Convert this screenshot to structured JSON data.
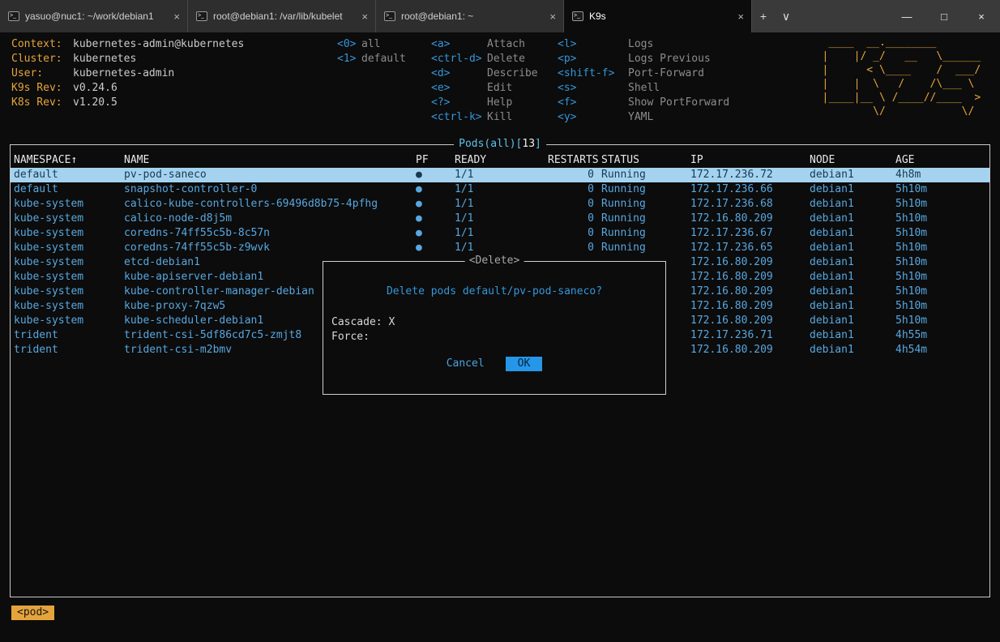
{
  "colors": {
    "accent_orange": "#e5a43b",
    "hotkey_blue": "#3596d8",
    "row_blue": "#57a7e0",
    "selected_row_bg": "#a5d3ef",
    "ok_button_bg": "#2596e8"
  },
  "icons": {
    "close": "×",
    "plus": "+",
    "chevron_down": "∨",
    "minimize": "—",
    "maximize": "□",
    "prompt": ">_"
  },
  "window": {
    "tabs": [
      {
        "label": "yasuo@nuc1: ~/work/debian1",
        "active": false
      },
      {
        "label": "root@debian1: /var/lib/kubelet",
        "active": false
      },
      {
        "label": "root@debian1: ~",
        "active": false
      },
      {
        "label": "K9s",
        "active": true
      }
    ]
  },
  "header": {
    "info": [
      {
        "label": "Context:",
        "value": "kubernetes-admin@kubernetes"
      },
      {
        "label": "Cluster:",
        "value": "kubernetes"
      },
      {
        "label": "User:",
        "value": "kubernetes-admin"
      },
      {
        "label": "K9s Rev:",
        "value": "v0.24.6"
      },
      {
        "label": "K8s Rev:",
        "value": "v1.20.5"
      }
    ],
    "hotkeys_col1": [
      {
        "key": "<0>",
        "label": "all"
      },
      {
        "key": "<1>",
        "label": "default"
      }
    ],
    "hotkeys_col2": [
      {
        "key": "<a>",
        "label": "Attach"
      },
      {
        "key": "<ctrl-d>",
        "label": "Delete"
      },
      {
        "key": "<d>",
        "label": "Describe"
      },
      {
        "key": "<e>",
        "label": "Edit"
      },
      {
        "key": "<?>",
        "label": "Help"
      },
      {
        "key": "<ctrl-k>",
        "label": "Kill"
      }
    ],
    "hotkeys_col3": [
      {
        "key": "<l>",
        "label": "Logs"
      },
      {
        "key": "<p>",
        "label": "Logs Previous"
      },
      {
        "key": "<shift-f>",
        "label": "Port-Forward"
      },
      {
        "key": "<s>",
        "label": "Shell"
      },
      {
        "key": "<f>",
        "label": "Show PortForward"
      },
      {
        "key": "<y>",
        "label": "YAML"
      }
    ],
    "logo_lines": [
      " ____  __.________       ",
      "|    |/ _/   __   \\______ ",
      "|      < \\____    /  ___/ ",
      "|    |  \\   /    /\\___ \\  ",
      "|____|__ \\ /____//____  > ",
      "        \\/            \\/  "
    ]
  },
  "table": {
    "title_prefix": "Pods(all)[",
    "title_count": "13",
    "title_suffix": "]",
    "columns": [
      "NAMESPACE↑",
      "NAME",
      "PF",
      "READY",
      "RESTARTS",
      "STATUS",
      "IP",
      "NODE",
      "AGE"
    ],
    "rows": [
      {
        "ns": "default",
        "name": "pv-pod-saneco",
        "pf": "●",
        "ready": "1/1",
        "restarts": "0",
        "status": "Running",
        "ip": "172.17.236.72",
        "node": "debian1",
        "age": "4h8m",
        "selected": true
      },
      {
        "ns": "default",
        "name": "snapshot-controller-0",
        "pf": "●",
        "ready": "1/1",
        "restarts": "0",
        "status": "Running",
        "ip": "172.17.236.66",
        "node": "debian1",
        "age": "5h10m",
        "selected": false
      },
      {
        "ns": "kube-system",
        "name": "calico-kube-controllers-69496d8b75-4pfhg",
        "pf": "●",
        "ready": "1/1",
        "restarts": "0",
        "status": "Running",
        "ip": "172.17.236.68",
        "node": "debian1",
        "age": "5h10m",
        "selected": false
      },
      {
        "ns": "kube-system",
        "name": "calico-node-d8j5m",
        "pf": "●",
        "ready": "1/1",
        "restarts": "0",
        "status": "Running",
        "ip": "172.16.80.209",
        "node": "debian1",
        "age": "5h10m",
        "selected": false
      },
      {
        "ns": "kube-system",
        "name": "coredns-74ff55c5b-8c57n",
        "pf": "●",
        "ready": "1/1",
        "restarts": "0",
        "status": "Running",
        "ip": "172.17.236.67",
        "node": "debian1",
        "age": "5h10m",
        "selected": false
      },
      {
        "ns": "kube-system",
        "name": "coredns-74ff55c5b-z9wvk",
        "pf": "●",
        "ready": "1/1",
        "restarts": "0",
        "status": "Running",
        "ip": "172.17.236.65",
        "node": "debian1",
        "age": "5h10m",
        "selected": false
      },
      {
        "ns": "kube-system",
        "name": "etcd-debian1",
        "pf": "",
        "ready": "",
        "restarts": "",
        "status": "",
        "ip": "172.16.80.209",
        "node": "debian1",
        "age": "5h10m",
        "selected": false
      },
      {
        "ns": "kube-system",
        "name": "kube-apiserver-debian1",
        "pf": "",
        "ready": "",
        "restarts": "",
        "status": "",
        "ip": "172.16.80.209",
        "node": "debian1",
        "age": "5h10m",
        "selected": false
      },
      {
        "ns": "kube-system",
        "name": "kube-controller-manager-debian",
        "pf": "",
        "ready": "",
        "restarts": "",
        "status": "",
        "ip": "172.16.80.209",
        "node": "debian1",
        "age": "5h10m",
        "selected": false
      },
      {
        "ns": "kube-system",
        "name": "kube-proxy-7qzw5",
        "pf": "",
        "ready": "",
        "restarts": "",
        "status": "",
        "ip": "172.16.80.209",
        "node": "debian1",
        "age": "5h10m",
        "selected": false
      },
      {
        "ns": "kube-system",
        "name": "kube-scheduler-debian1",
        "pf": "",
        "ready": "",
        "restarts": "",
        "status": "",
        "ip": "172.16.80.209",
        "node": "debian1",
        "age": "5h10m",
        "selected": false
      },
      {
        "ns": "trident",
        "name": "trident-csi-5df86cd7c5-zmjt8",
        "pf": "",
        "ready": "",
        "restarts": "",
        "status": "",
        "ip": "172.17.236.71",
        "node": "debian1",
        "age": "4h55m",
        "selected": false
      },
      {
        "ns": "trident",
        "name": "trident-csi-m2bmv",
        "pf": "",
        "ready": "",
        "restarts": "",
        "status": "",
        "ip": "172.16.80.209",
        "node": "debian1",
        "age": "4h54m",
        "selected": false
      }
    ]
  },
  "dialog": {
    "title": "<Delete>",
    "question": "Delete pods default/pv-pod-saneco?",
    "cascade_label": "Cascade:",
    "cascade_value": "X",
    "force_label": "Force:",
    "force_value": "",
    "cancel": "Cancel",
    "ok": "OK"
  },
  "footer": {
    "crumb": "<pod>"
  }
}
